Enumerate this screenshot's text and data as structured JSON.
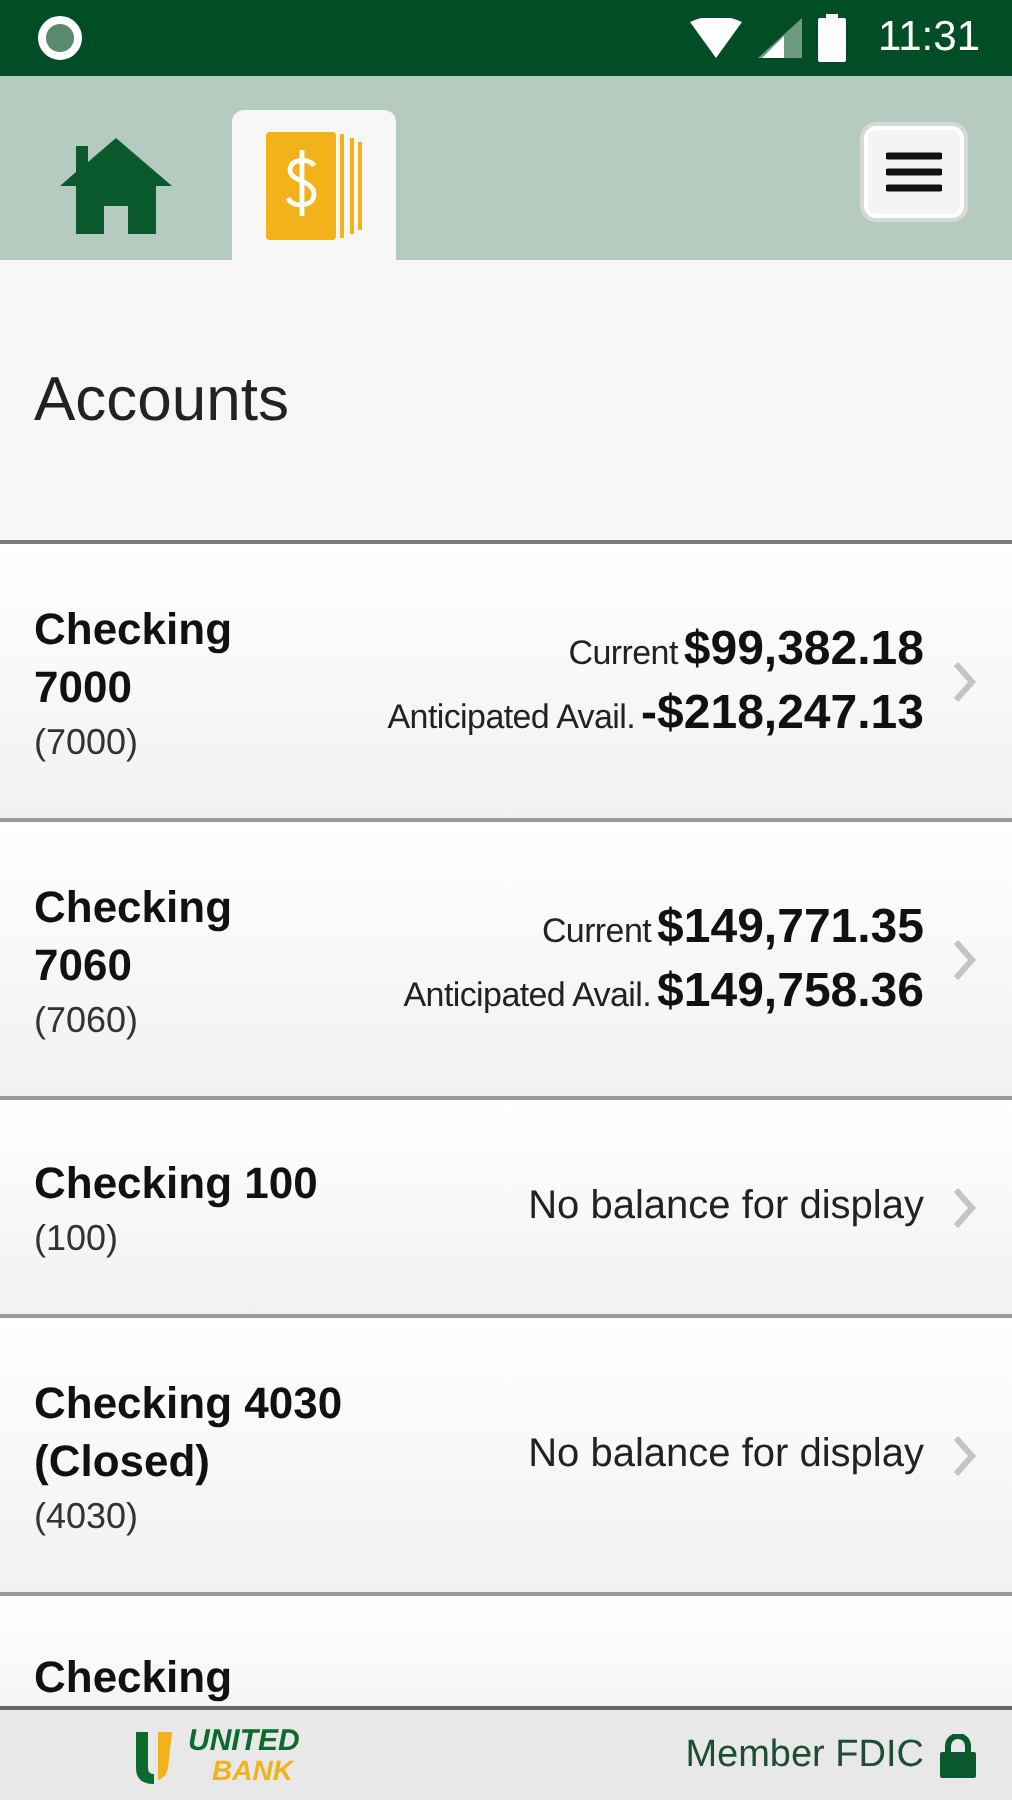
{
  "status_bar": {
    "time": "11:31"
  },
  "tabs": [
    {
      "kind": "home",
      "selected": false
    },
    {
      "kind": "accounts",
      "selected": true
    }
  ],
  "header": {
    "title": "Accounts"
  },
  "accounts": [
    {
      "name": "Checking 7000",
      "number": "(7000)",
      "balances": [
        {
          "label": "Current",
          "amount": "$99,382.18"
        },
        {
          "label": "Anticipated Avail.",
          "amount": "-$218,247.13"
        }
      ]
    },
    {
      "name": "Checking 7060",
      "number": "(7060)",
      "balances": [
        {
          "label": "Current",
          "amount": "$149,771.35"
        },
        {
          "label": "Anticipated Avail.",
          "amount": "$149,758.36"
        }
      ]
    },
    {
      "name": "Checking 100",
      "number": "(100)",
      "message": "No balance for display"
    },
    {
      "name": "Checking 4030 (Closed)",
      "number": "(4030)",
      "message": "No balance for display"
    },
    {
      "name": "Checking"
    }
  ],
  "footer": {
    "logo_top": "UNITED",
    "logo_bottom": "BANK",
    "fdic": "Member FDIC"
  }
}
